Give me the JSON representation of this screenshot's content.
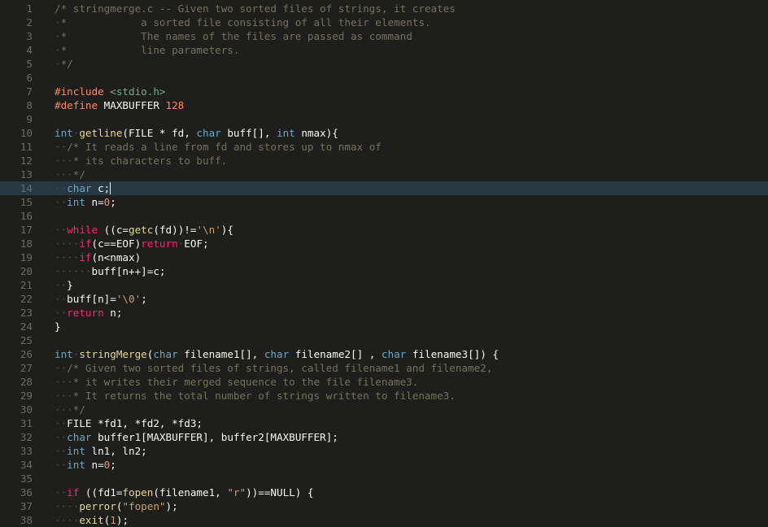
{
  "editor": {
    "current_line": 14,
    "colors": {
      "background": "#1e1f1c",
      "current_line": "#263943",
      "line_number": "#6b6b66",
      "comment": "#75715e",
      "keyword": "#f92672",
      "preprocessor": "#f98b62",
      "type": "#66a9c6",
      "function": "#e4d78c",
      "string": "#c2a26a",
      "whitespace_marker": "#505048"
    },
    "lines": [
      {
        "n": "1",
        "tokens": [
          [
            "comment",
            "/* stringmerge.c -- Given two sorted files of strings, it creates"
          ]
        ]
      },
      {
        "n": "2",
        "tokens": [
          [
            "ws",
            "·"
          ],
          [
            "comment",
            "*            a sorted file consisting of all their elements."
          ]
        ]
      },
      {
        "n": "3",
        "tokens": [
          [
            "ws",
            "·"
          ],
          [
            "comment",
            "*            The names of the files are passed as command"
          ]
        ]
      },
      {
        "n": "4",
        "tokens": [
          [
            "ws",
            "·"
          ],
          [
            "comment",
            "*            line parameters."
          ]
        ]
      },
      {
        "n": "5",
        "tokens": [
          [
            "ws",
            "·"
          ],
          [
            "comment",
            "*/"
          ]
        ]
      },
      {
        "n": "6",
        "tokens": []
      },
      {
        "n": "7",
        "tokens": [
          [
            "preproc",
            "#include"
          ],
          [
            "plain",
            " "
          ],
          [
            "header",
            "<stdio.h>"
          ]
        ]
      },
      {
        "n": "8",
        "tokens": [
          [
            "preproc",
            "#define"
          ],
          [
            "plain",
            " MAXBUFFER "
          ],
          [
            "number",
            "128"
          ]
        ]
      },
      {
        "n": "9",
        "tokens": []
      },
      {
        "n": "10",
        "tokens": [
          [
            "type",
            "int"
          ],
          [
            "ws",
            "·"
          ],
          [
            "func",
            "getline"
          ],
          [
            "plain",
            "(FILE * fd, "
          ],
          [
            "type",
            "char"
          ],
          [
            "plain",
            " buff[], "
          ],
          [
            "type",
            "int"
          ],
          [
            "plain",
            " nmax){"
          ]
        ]
      },
      {
        "n": "11",
        "tokens": [
          [
            "ws",
            "··"
          ],
          [
            "comment",
            "/* It reads a line from fd and stores up to nmax of"
          ]
        ]
      },
      {
        "n": "12",
        "tokens": [
          [
            "ws",
            "···"
          ],
          [
            "comment",
            "* its characters to buff."
          ]
        ]
      },
      {
        "n": "13",
        "tokens": [
          [
            "ws",
            "···"
          ],
          [
            "comment",
            "*/"
          ]
        ]
      },
      {
        "n": "14",
        "tokens": [
          [
            "ws",
            "··"
          ],
          [
            "type",
            "char"
          ],
          [
            "plain",
            " c;"
          ]
        ]
      },
      {
        "n": "15",
        "tokens": [
          [
            "ws",
            "··"
          ],
          [
            "type",
            "int"
          ],
          [
            "plain",
            " n="
          ],
          [
            "number",
            "0"
          ],
          [
            "plain",
            ";"
          ]
        ]
      },
      {
        "n": "16",
        "tokens": []
      },
      {
        "n": "17",
        "tokens": [
          [
            "ws",
            "··"
          ],
          [
            "keyword",
            "while"
          ],
          [
            "plain",
            " ((c="
          ],
          [
            "func",
            "getc"
          ],
          [
            "plain",
            "(fd))!="
          ],
          [
            "string",
            "'\\n'"
          ],
          [
            "plain",
            "){"
          ]
        ]
      },
      {
        "n": "18",
        "tokens": [
          [
            "ws",
            "····"
          ],
          [
            "keyword",
            "if"
          ],
          [
            "plain",
            "(c==EOF)"
          ],
          [
            "keyword",
            "return"
          ],
          [
            "ws",
            "·"
          ],
          [
            "plain",
            "EOF;"
          ]
        ]
      },
      {
        "n": "19",
        "tokens": [
          [
            "ws",
            "····"
          ],
          [
            "keyword",
            "if"
          ],
          [
            "plain",
            "(n<nmax)"
          ]
        ]
      },
      {
        "n": "20",
        "tokens": [
          [
            "ws",
            "······"
          ],
          [
            "plain",
            "buff[n++]=c;"
          ]
        ]
      },
      {
        "n": "21",
        "tokens": [
          [
            "ws",
            "··"
          ],
          [
            "plain",
            "}"
          ]
        ]
      },
      {
        "n": "22",
        "tokens": [
          [
            "ws",
            "··"
          ],
          [
            "plain",
            "buff[n]="
          ],
          [
            "string",
            "'\\0'"
          ],
          [
            "plain",
            ";"
          ]
        ]
      },
      {
        "n": "23",
        "tokens": [
          [
            "ws",
            "··"
          ],
          [
            "keyword",
            "return"
          ],
          [
            "plain",
            " n;"
          ]
        ]
      },
      {
        "n": "24",
        "tokens": [
          [
            "plain",
            "}"
          ]
        ]
      },
      {
        "n": "25",
        "tokens": []
      },
      {
        "n": "26",
        "tokens": [
          [
            "type",
            "int"
          ],
          [
            "ws",
            "·"
          ],
          [
            "func",
            "stringMerge"
          ],
          [
            "plain",
            "("
          ],
          [
            "type",
            "char"
          ],
          [
            "plain",
            " filename1[], "
          ],
          [
            "type",
            "char"
          ],
          [
            "plain",
            " filename2[] , "
          ],
          [
            "type",
            "char"
          ],
          [
            "plain",
            " filename3[]) {"
          ]
        ]
      },
      {
        "n": "27",
        "tokens": [
          [
            "ws",
            "··"
          ],
          [
            "comment",
            "/* Given two sorted files of strings, called filename1 and filename2,"
          ]
        ]
      },
      {
        "n": "28",
        "tokens": [
          [
            "ws",
            "···"
          ],
          [
            "comment",
            "* it writes their merged sequence to the file filename3."
          ]
        ]
      },
      {
        "n": "29",
        "tokens": [
          [
            "ws",
            "···"
          ],
          [
            "comment",
            "* It returns the total number of strings written to filename3."
          ]
        ]
      },
      {
        "n": "30",
        "tokens": [
          [
            "ws",
            "···"
          ],
          [
            "comment",
            "*/"
          ]
        ]
      },
      {
        "n": "31",
        "tokens": [
          [
            "ws",
            "··"
          ],
          [
            "plain",
            "FILE *fd1, *fd2, *fd3;"
          ]
        ]
      },
      {
        "n": "32",
        "tokens": [
          [
            "ws",
            "··"
          ],
          [
            "type",
            "char"
          ],
          [
            "plain",
            " buffer1[MAXBUFFER], buffer2[MAXBUFFER];"
          ]
        ]
      },
      {
        "n": "33",
        "tokens": [
          [
            "ws",
            "··"
          ],
          [
            "type",
            "int"
          ],
          [
            "plain",
            " ln1, ln2;"
          ]
        ]
      },
      {
        "n": "34",
        "tokens": [
          [
            "ws",
            "··"
          ],
          [
            "type",
            "int"
          ],
          [
            "plain",
            " n="
          ],
          [
            "number",
            "0"
          ],
          [
            "plain",
            ";"
          ]
        ]
      },
      {
        "n": "35",
        "tokens": []
      },
      {
        "n": "36",
        "tokens": [
          [
            "ws",
            "··"
          ],
          [
            "keyword",
            "if"
          ],
          [
            "plain",
            " ((fd1="
          ],
          [
            "func",
            "fopen"
          ],
          [
            "plain",
            "(filename1, "
          ],
          [
            "string",
            "\"r\""
          ],
          [
            "plain",
            "))==NULL) {"
          ]
        ]
      },
      {
        "n": "37",
        "tokens": [
          [
            "ws",
            "····"
          ],
          [
            "func",
            "perror"
          ],
          [
            "plain",
            "("
          ],
          [
            "string",
            "\"fopen\""
          ],
          [
            "plain",
            ");"
          ]
        ]
      },
      {
        "n": "38",
        "tokens": [
          [
            "ws",
            "····"
          ],
          [
            "func",
            "exit"
          ],
          [
            "plain",
            "("
          ],
          [
            "number",
            "1"
          ],
          [
            "plain",
            ");"
          ]
        ]
      }
    ]
  }
}
